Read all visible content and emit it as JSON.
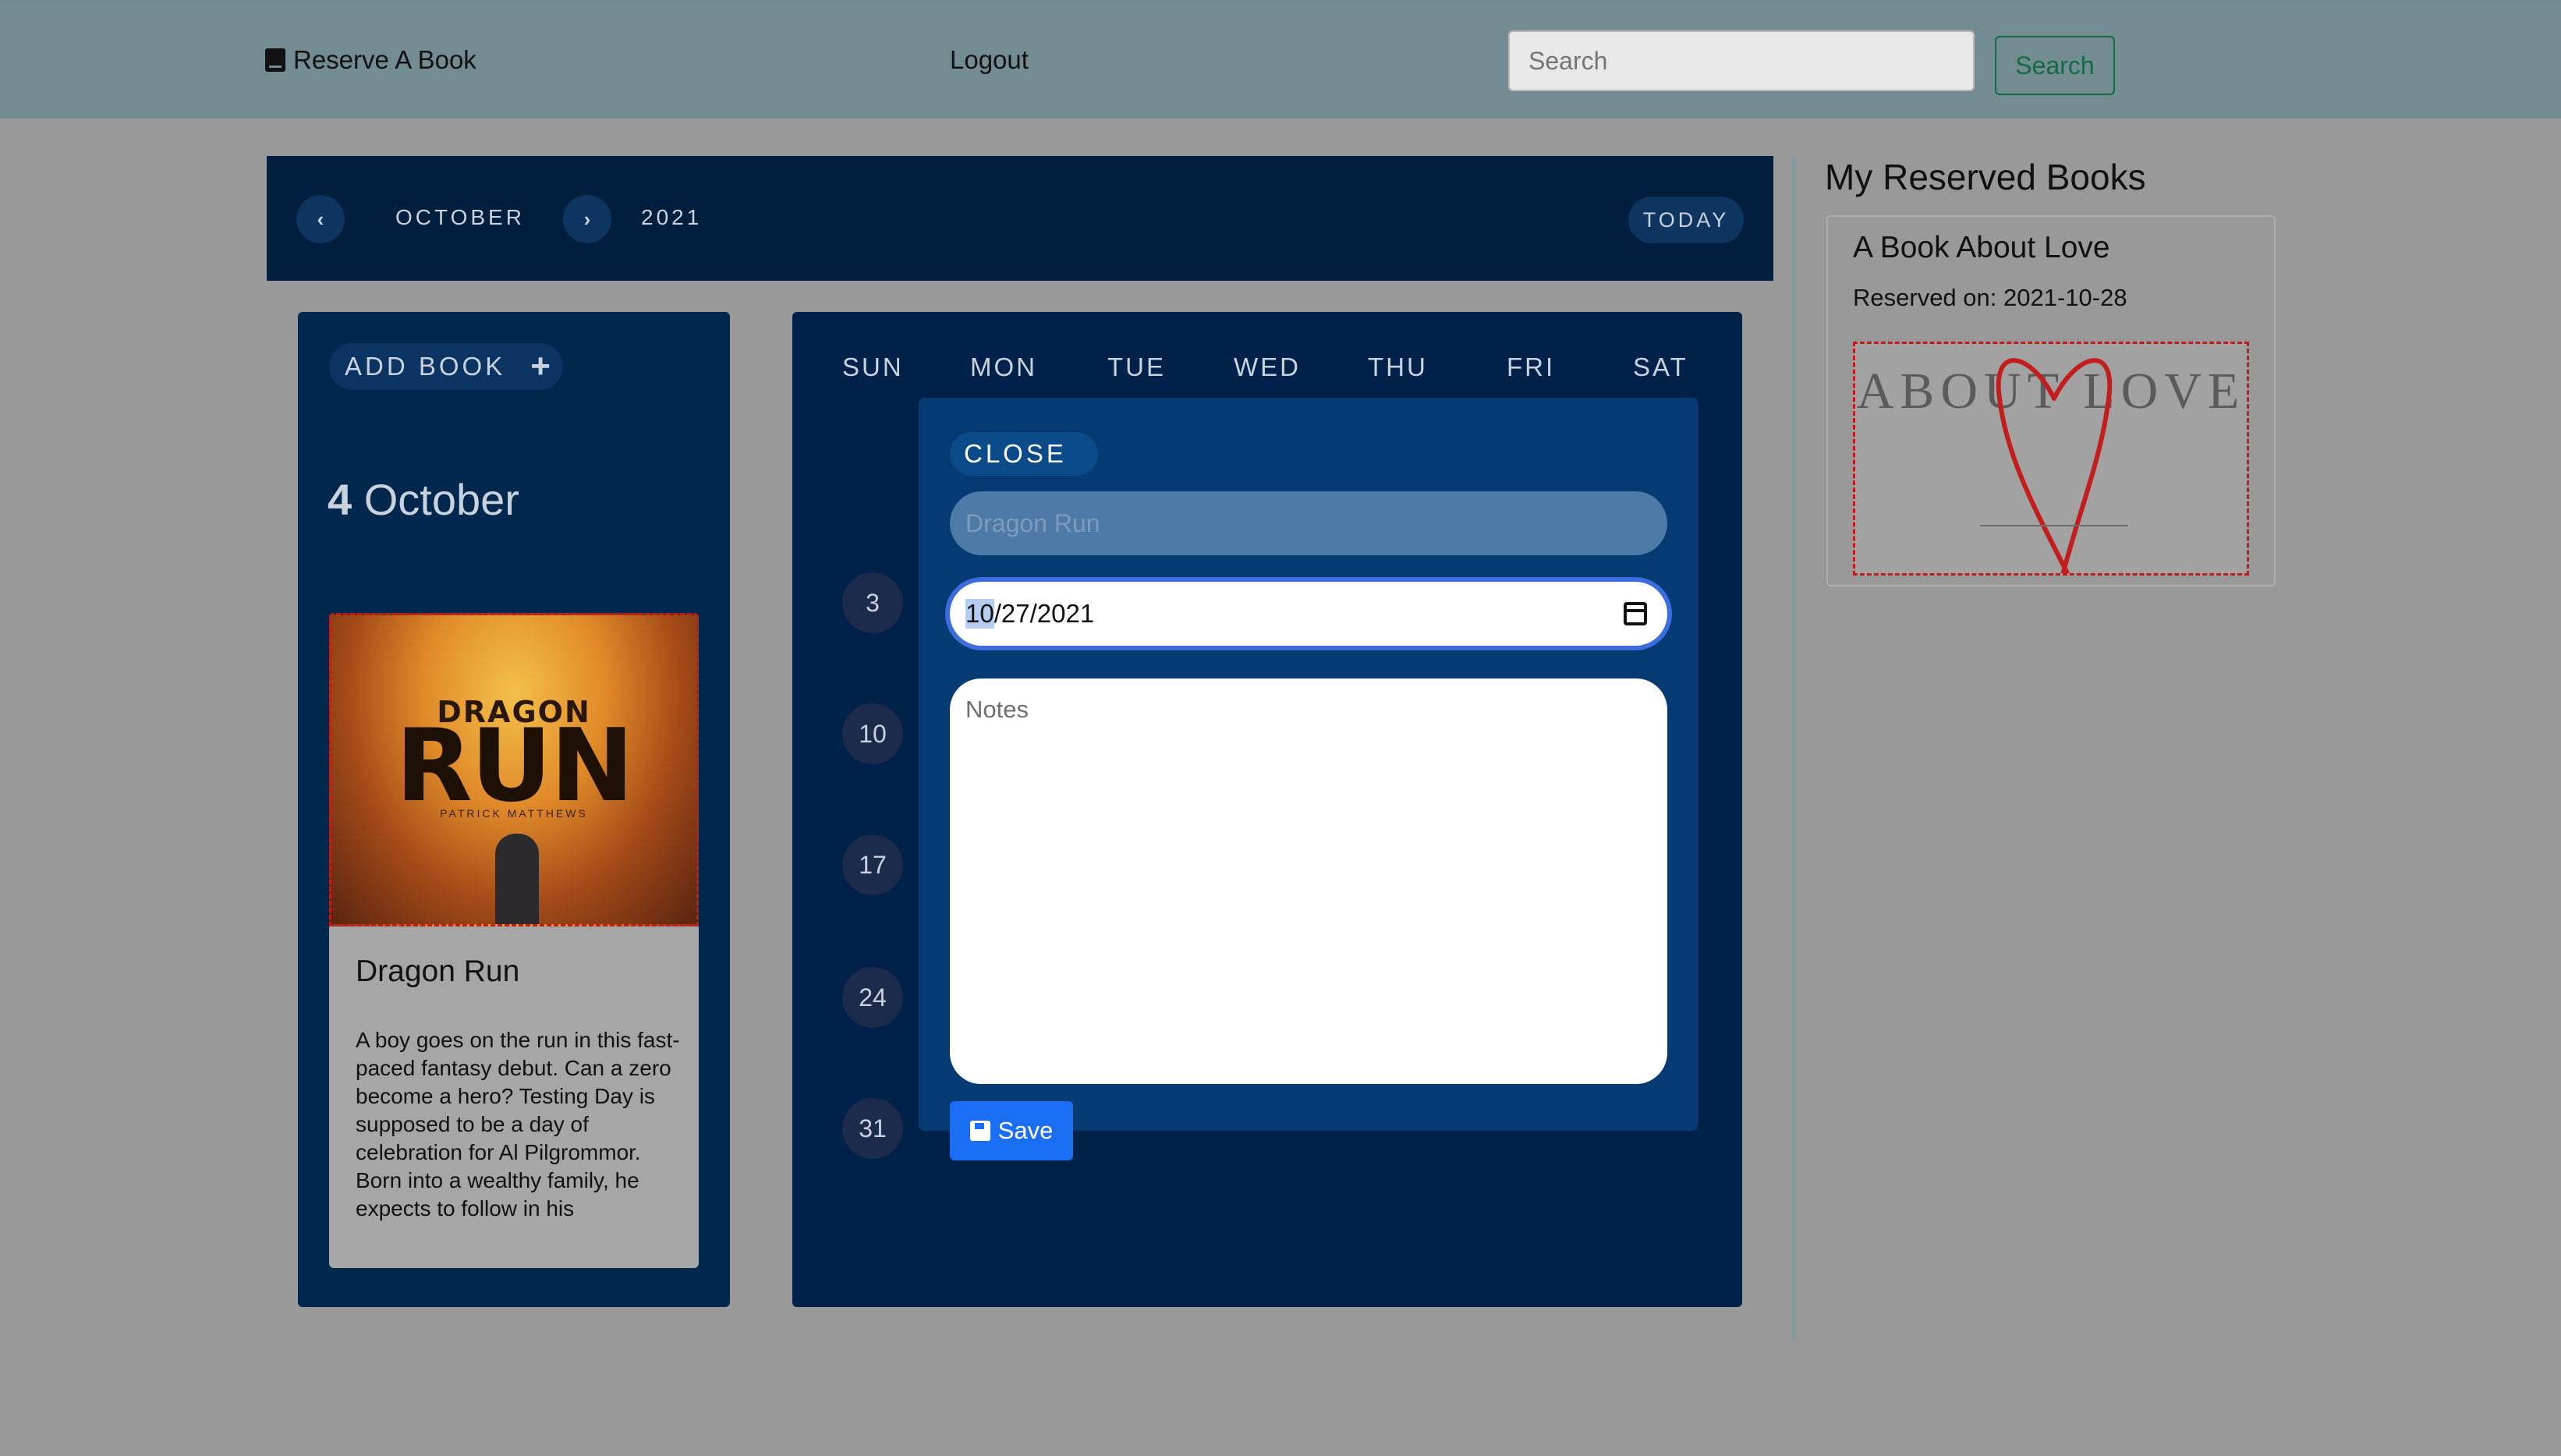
{
  "navbar": {
    "brand": "Reserve A Book",
    "logout": "Logout",
    "search_placeholder": "Search",
    "search_button": "Search"
  },
  "calendar_header": {
    "prev_icon": "‹",
    "month": "OCTOBER",
    "next_icon": "›",
    "year": "2021",
    "today": "TODAY"
  },
  "left_panel": {
    "add_book": "ADD BOOK",
    "add_icon": "+",
    "day_number": "4",
    "day_month": "October",
    "book": {
      "cover_top": "DRAGON",
      "cover_main": "RUN",
      "cover_author": "PATRICK MATTHEWS",
      "title": "Dragon Run",
      "description": "A boy goes on the run in this fast-paced fantasy debut. Can a zero become a hero? Testing Day is supposed to be a day of celebration for Al Pilgrommor. Born into a wealthy family, he expects to follow in his"
    }
  },
  "calendar": {
    "weekdays": [
      "SUN",
      "MON",
      "TUE",
      "WED",
      "THU",
      "FRI",
      "SAT"
    ],
    "sundays": [
      "3",
      "10",
      "17",
      "24",
      "31"
    ]
  },
  "modal": {
    "close": "CLOSE",
    "title_value": "Dragon Run",
    "date_selected": "10",
    "date_rest": "/27/2021",
    "notes_placeholder": "Notes",
    "save": "Save"
  },
  "sidebar": {
    "heading": "My Reserved Books",
    "books": [
      {
        "title": "A Book About Love",
        "reserved_on": "Reserved on: 2021-10-28",
        "cover_text": "ABOUT LOVE"
      }
    ]
  },
  "colors": {
    "navbar": "#728c91",
    "page_background": "#999999",
    "calendar_header": "#001e3d",
    "panel": "#00274e",
    "modal": "#063a73",
    "save_button": "#1a6ef3",
    "search_button": "#146c43"
  }
}
